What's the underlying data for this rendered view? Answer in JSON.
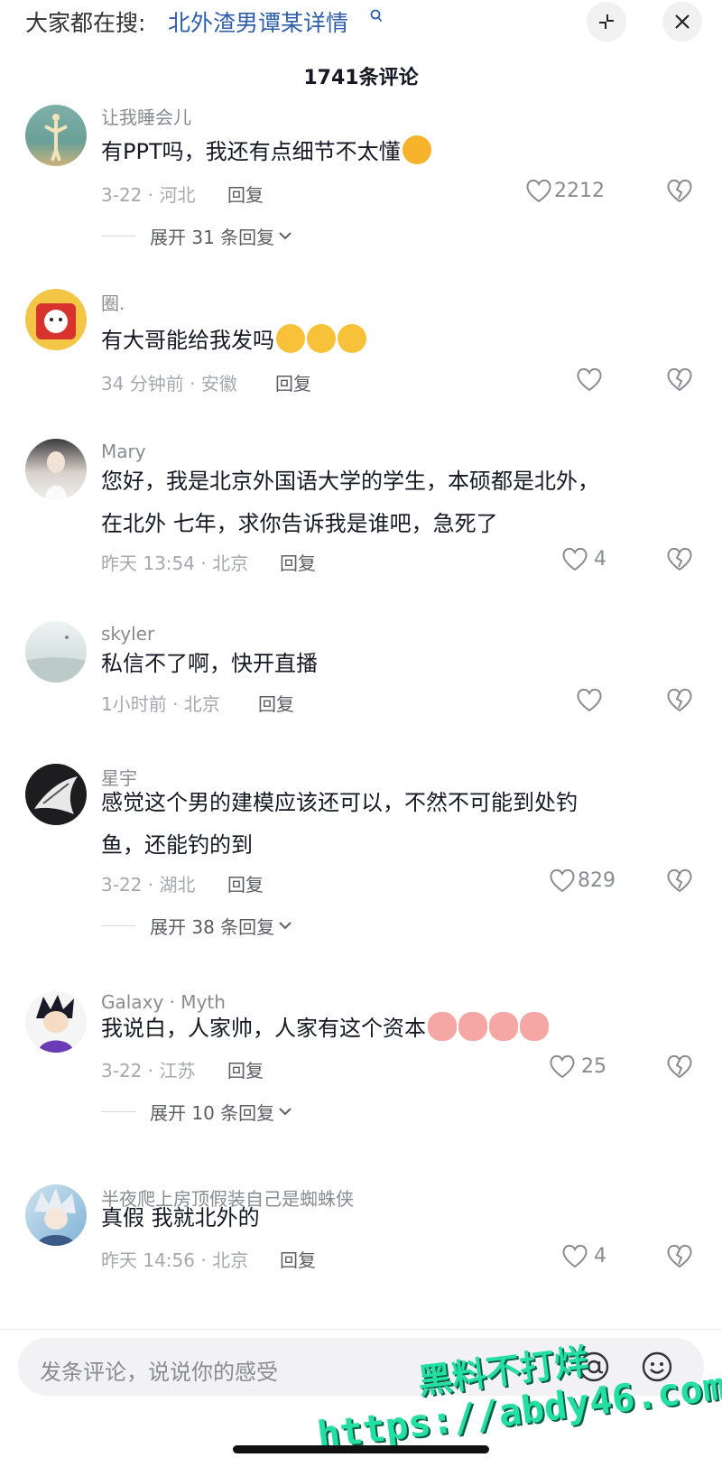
{
  "header": {
    "search_prefix": "大家都在搜:",
    "search_term": "北外渣男谭某详情",
    "collapse_icon": "collapse-icon",
    "close_icon": "close-icon",
    "comment_count": "1741条评论"
  },
  "comments": [
    {
      "username": "让我睡会儿",
      "text": "有PPT吗，我还有点细节不太懂",
      "emojis": [
        "smug-face-emoji"
      ],
      "meta": "3-22 · 河北",
      "reply_label": "回复",
      "likes": "2212",
      "expand_label": "展开 31 条回复"
    },
    {
      "username": "圈.",
      "text": "有大哥能给我发吗",
      "emojis": [
        "crying-face-emoji",
        "crying-face-emoji",
        "crying-face-emoji"
      ],
      "meta": "34 分钟前 · 安徽",
      "reply_label": "回复",
      "likes": ""
    },
    {
      "username": "Mary",
      "text_lines": [
        "您好，我是北京外国语大学的学生，本硕都是北外，",
        "在北外 七年，求你告诉我是谁吧，急死了"
      ],
      "meta": "昨天 13:54 · 北京",
      "reply_label": "回复",
      "likes": "4"
    },
    {
      "username": "skyler",
      "text": "私信不了啊，快开直播",
      "meta": "1小时前 · 北京",
      "reply_label": "回复",
      "likes": ""
    },
    {
      "username": "星宇",
      "text_lines": [
        "感觉这个男的建模应该还可以，不然不可能到处钓",
        "鱼，还能钓的到"
      ],
      "meta": "3-22 · 湖北",
      "reply_label": "回复",
      "likes": "829",
      "expand_label": "展开 38 条回复"
    },
    {
      "username": "Galaxy · Myth",
      "text": "我说白，人家帅，人家有这个资本",
      "emojis": [
        "pig-face-emoji",
        "pig-face-emoji",
        "pig-face-emoji",
        "pig-face-emoji"
      ],
      "meta": "3-22 · 江苏",
      "reply_label": "回复",
      "likes": "25",
      "expand_label": "展开 10 条回复"
    },
    {
      "username": "半夜爬上房顶假装自己是蜘蛛侠",
      "text": "真假 我就北外的",
      "meta": "昨天 14:56 · 北京",
      "reply_label": "回复",
      "likes": "4"
    }
  ],
  "input": {
    "placeholder": "发条评论，说说你的感受",
    "mention_icon": "at-icon",
    "emoji_icon": "emoji-icon"
  },
  "watermark": {
    "line1": "黑料不打烊",
    "line2": "https://abdy46.com"
  },
  "colors": {
    "link_blue": "#2f5fa8",
    "text_primary": "#161823",
    "text_secondary": "#8a8b91",
    "watermark_green": "#23e0a0"
  }
}
